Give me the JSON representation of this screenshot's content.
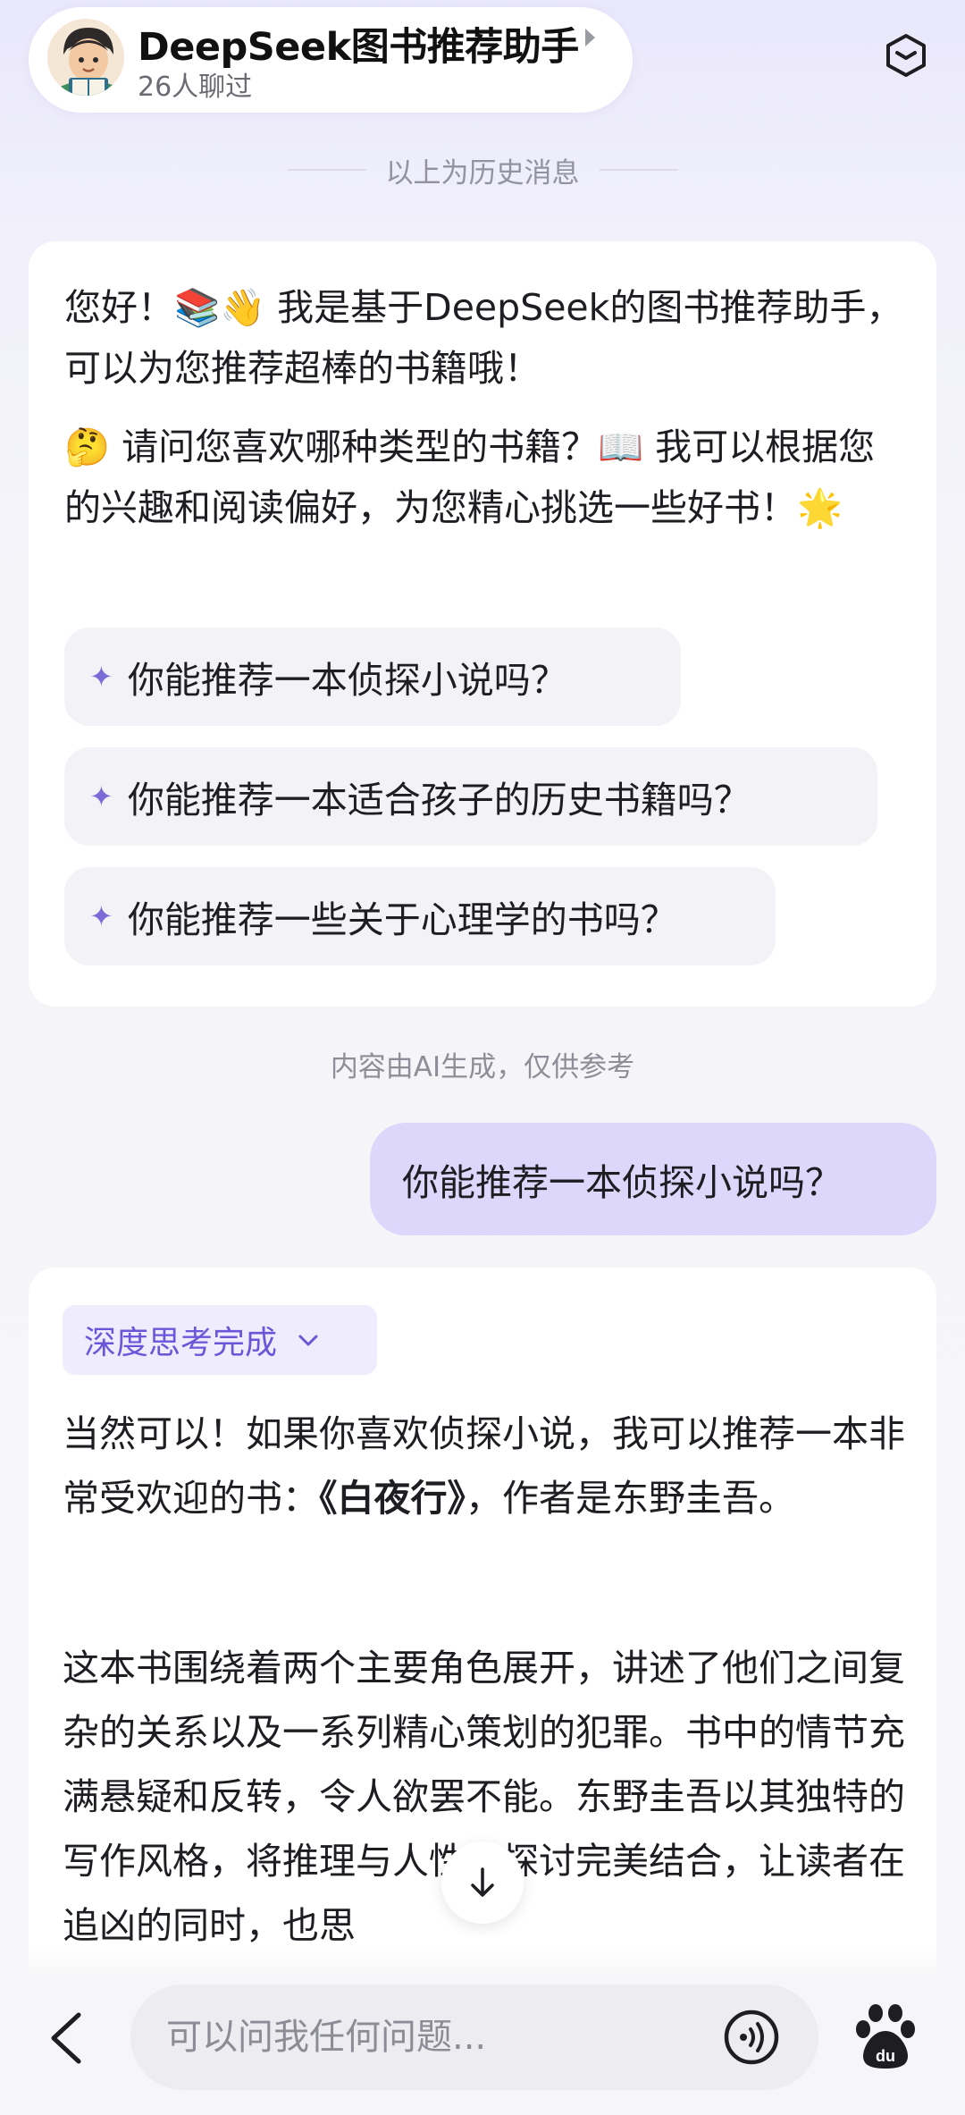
{
  "header": {
    "bot_name": "DeepSeek图书推荐助手",
    "chat_count": "26人聊过"
  },
  "history_divider": "以上为历史消息",
  "greeting": {
    "paragraph1": "您好！📚👋 我是基于DeepSeek的图书推荐助手，可以为您推荐超棒的书籍哦！",
    "paragraph2": "🤔 请问您喜欢哪种类型的书籍？📖 我可以根据您的兴趣和阅读偏好，为您精心挑选一些好书！🌟",
    "suggestions": [
      "你能推荐一本侦探小说吗？",
      "你能推荐一本适合孩子的历史书籍吗？",
      "你能推荐一些关于心理学的书吗？"
    ]
  },
  "ai_note": "内容由AI生成，仅供参考",
  "user_message": "你能推荐一本侦探小说吗？",
  "reply": {
    "thinking_label": "深度思考完成",
    "p1_before": "当然可以！如果你喜欢侦探小说，我可以推荐一本非常受欢迎的书：",
    "book_title": "《白夜行》",
    "p1_after": "，作者是东野圭吾。",
    "paragraph2": "这本书围绕着两个主要角色展开，讲述了他们之间复杂的关系以及一系列精心策划的犯罪。书中的情节充满悬疑和反转，令人欲罢不能。东野圭吾以其独特的写作风格，将推理与人性的探讨完美结合，让读者在追凶的同时，也思"
  },
  "input": {
    "placeholder": "可以问我任何问题..."
  },
  "colors": {
    "accent": "#6a56d9",
    "user_bubble": "#dcd7fb",
    "chip_bg": "#efecfd"
  },
  "icons": [
    "cube-icon",
    "sparkle-icon",
    "chevron-down-icon",
    "arrow-down-icon",
    "back-arrow-icon",
    "voice-icon",
    "baidu-paw-icon"
  ]
}
